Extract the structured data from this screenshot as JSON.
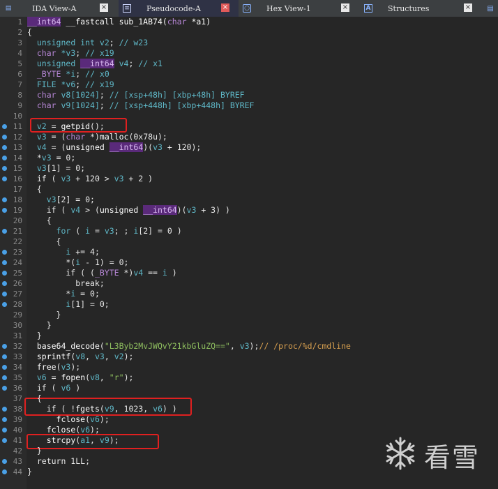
{
  "tabs": [
    {
      "label": "IDA View-A",
      "icon": "ida-view-icon",
      "close": "×",
      "active": false
    },
    {
      "label": "Pseudocode-A",
      "icon": "pseudocode-icon",
      "close": "×",
      "active": true
    },
    {
      "label": "Hex View-1",
      "icon": "hex-view-icon",
      "close": "×",
      "active": false
    },
    {
      "label": "Structures",
      "icon": "structures-icon",
      "close": "×",
      "active": false
    }
  ],
  "code": {
    "line_numbers": [
      "1",
      "2",
      "3",
      "4",
      "5",
      "6",
      "7",
      "8",
      "9",
      "10",
      "11",
      "12",
      "13",
      "14",
      "15",
      "16",
      "17",
      "18",
      "19",
      "20",
      "21",
      "22",
      "23",
      "24",
      "25",
      "26",
      "27",
      "28",
      "29",
      "30",
      "31",
      "32",
      "33",
      "34",
      "35",
      "36",
      "37",
      "38",
      "39",
      "40",
      "41",
      "42",
      "43",
      "44"
    ],
    "lines": [
      "__int64 __fastcall sub_1AB74(char *a1)",
      "{",
      "  unsigned int v2; // w23",
      "  char *v3; // x19",
      "  unsigned __int64 v4; // x1",
      "  _BYTE *i; // x0",
      "  FILE *v6; // x19",
      "  char v8[1024]; // [xsp+48h] [xbp+48h] BYREF",
      "  char v9[1024]; // [xsp+448h] [xbp+448h] BYREF",
      "",
      "  v2 = getpid();",
      "  v3 = (char *)malloc(0x78u);",
      "  v4 = (unsigned __int64)(v3 + 120);",
      "  *v3 = 0;",
      "  v3[1] = 0;",
      "  if ( v3 + 120 > v3 + 2 )",
      "  {",
      "    v3[2] = 0;",
      "    if ( v4 > (unsigned __int64)(v3 + 3) )",
      "    {",
      "      for ( i = v3; ; i[2] = 0 )",
      "      {",
      "        i += 4;",
      "        *(i - 1) = 0;",
      "        if ( (_BYTE *)v4 == i )",
      "          break;",
      "        *i = 0;",
      "        i[1] = 0;",
      "      }",
      "    }",
      "  }",
      "  base64_decode(\"L3Byb2MvJWQvY21kbGluZQ==\", v3);// /proc/%d/cmdline",
      "  sprintf(v8, v3, v2);",
      "  free(v3);",
      "  v6 = fopen(v8, \"r\");",
      "  if ( v6 )",
      "  {",
      "    if ( !fgets(v9, 1023, v6) )",
      "      fclose(v6);",
      "    fclose(v6);",
      "    strcpy(a1, v9);",
      "  }",
      "  return 1LL;",
      "}"
    ]
  },
  "watermark": {
    "text": "看雪",
    "icon": "snowflake-logo-icon"
  },
  "colors": {
    "highlight_box": "#e02020",
    "keyword": "#5fb8c8",
    "string": "#8fbf5f",
    "comment": "#d8a050",
    "highlight": "#5a2a7a"
  }
}
